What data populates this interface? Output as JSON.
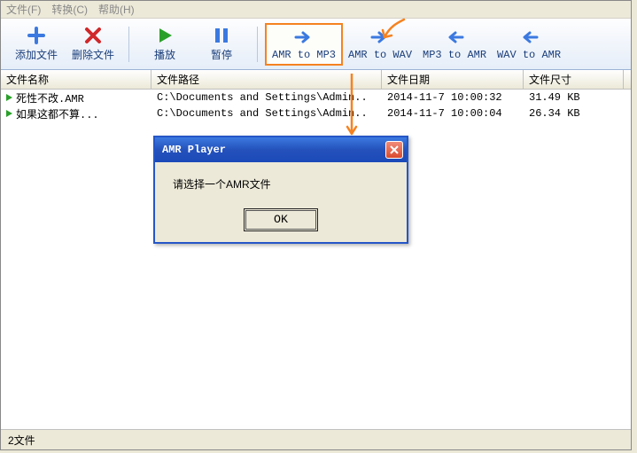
{
  "menu": {
    "file": "文件(F)",
    "convert": "转换(C)",
    "help": "帮助(H)"
  },
  "toolbar": {
    "add": "添加文件",
    "delete": "删除文件",
    "play": "播放",
    "pause": "暂停",
    "amr_to_mp3": "AMR to MP3",
    "amr_to_wav": "AMR to WAV",
    "mp3_to_amr": "MP3 to AMR",
    "wav_to_amr": "WAV to AMR"
  },
  "columns": {
    "name": "文件名称",
    "path": "文件路径",
    "date": "文件日期",
    "size": "文件尺寸"
  },
  "files": [
    {
      "name": "死性不改.AMR",
      "path": "C:\\Documents and Settings\\Admin..",
      "date": "2014-11-7 10:00:32",
      "size": "31.49 KB"
    },
    {
      "name": "如果这都不算...",
      "path": "C:\\Documents and Settings\\Admin..",
      "date": "2014-11-7 10:00:04",
      "size": "26.34 KB"
    }
  ],
  "dialog": {
    "title": "AMR Player",
    "message": "请选择一个AMR文件",
    "ok": "OK"
  },
  "status": {
    "text": "2文件"
  },
  "colors": {
    "accent_blue": "#1a3e7a",
    "highlight_orange": "#f58220",
    "titlebar_blue": "#2556c7",
    "play_green": "#2aa02a"
  }
}
